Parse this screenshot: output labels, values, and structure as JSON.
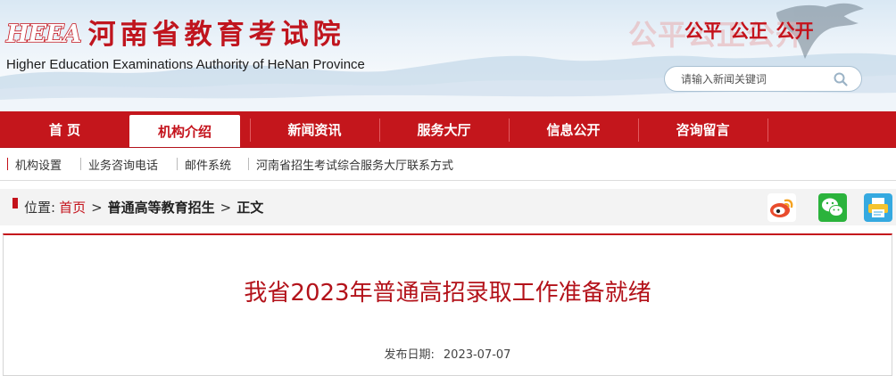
{
  "header": {
    "logo_mark": "HEEA",
    "logo_cn": "河南省教育考试院",
    "logo_en": "Higher Education Examinations Authority of HeNan Province",
    "slogan_ghost": "公平公正公开",
    "slogan": "公平 公正 公开"
  },
  "search": {
    "placeholder": "请输入新闻关键词",
    "icon": "search-icon"
  },
  "nav": {
    "items": [
      {
        "label": "首 页"
      },
      {
        "label": "机构介绍"
      },
      {
        "label": "新闻资讯"
      },
      {
        "label": "服务大厅"
      },
      {
        "label": "信息公开"
      },
      {
        "label": "咨询留言"
      }
    ],
    "active_index": 1
  },
  "subnav": {
    "items": [
      {
        "label": "机构设置"
      },
      {
        "label": "业务咨询电话"
      },
      {
        "label": "邮件系统"
      },
      {
        "label": "河南省招生考试综合服务大厅联系方式"
      }
    ]
  },
  "breadcrumb": {
    "prefix": "位置:",
    "home": "首页",
    "section": "普通高等教育招生",
    "current": "正文",
    "separator": ">"
  },
  "share": {
    "icons": [
      "weibo-icon",
      "wechat-icon",
      "print-icon"
    ]
  },
  "article": {
    "title": "我省2023年普通高招录取工作准备就绪",
    "date_label": "发布日期:",
    "date_value": "2023-07-07"
  },
  "colors": {
    "brand_red": "#c4161c",
    "weibo_orange": "#f5a21f",
    "wechat_green": "#2bb33c",
    "print_blue": "#35a9e0"
  }
}
